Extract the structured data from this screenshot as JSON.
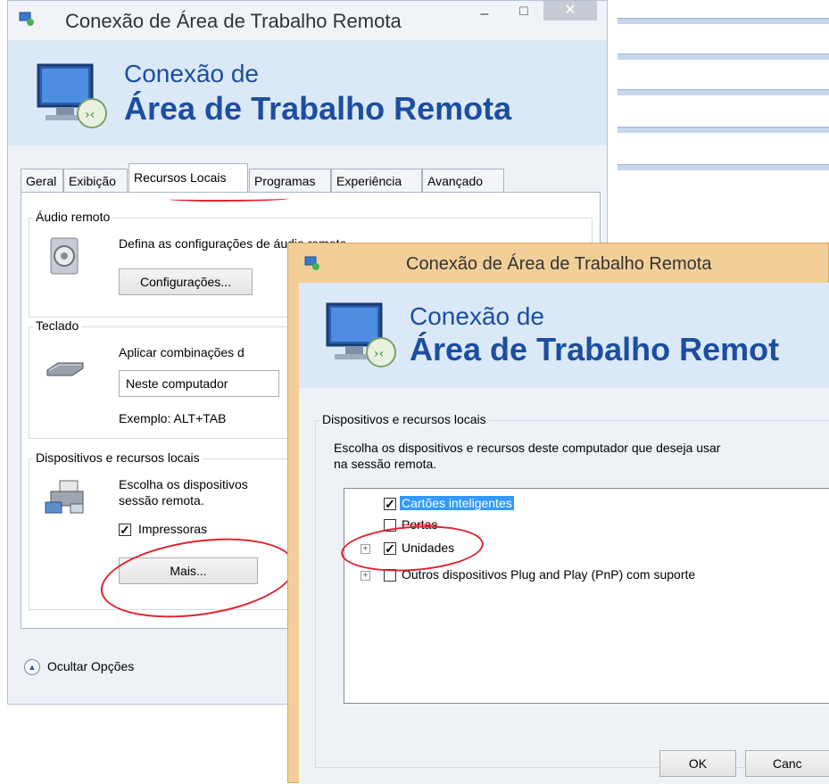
{
  "app_title": "Conexão de Área de Trabalho Remota",
  "main_window": {
    "title": "Conexão de Área de Trabalho Remota",
    "banner_line1": "Conexão de",
    "banner_line2": "Área de Trabalho Remota",
    "window_buttons": {
      "minimize": "–",
      "maximize": "☐",
      "close": "✕"
    },
    "tabs": [
      {
        "label": "Geral",
        "active": false
      },
      {
        "label": "Exibição",
        "active": false
      },
      {
        "label": "Recursos Locais",
        "active": true
      },
      {
        "label": "Programas",
        "active": false
      },
      {
        "label": "Experiência",
        "active": false
      },
      {
        "label": "Avançado",
        "active": false
      }
    ],
    "audio": {
      "group_label": "Áudio remoto",
      "description": "Defina as configurações de áudio remoto",
      "button": "Configurações..."
    },
    "keyboard": {
      "group_label": "Teclado",
      "description": "Aplicar combinações d",
      "selected": "Neste computador",
      "example": "Exemplo: ALT+TAB"
    },
    "devices": {
      "group_label": "Dispositivos e recursos locais",
      "description_line1": "Escolha os dispositivos",
      "description_line2": "sessão remota.",
      "printers_label": "Impressoras",
      "printers_checked": true,
      "more_button": "Mais..."
    },
    "hide_options": "Ocultar Opções"
  },
  "dialog": {
    "title": "Conexão de Área de Trabalho Remota",
    "banner_line1": "Conexão de",
    "banner_line2": "Área de Trabalho Remot",
    "group_label": "Dispositivos e recursos locais",
    "description_line1": "Escolha os dispositivos e recursos deste computador que deseja usar",
    "description_line2": "na sessão remota.",
    "items": [
      {
        "label": "Cartões inteligentes",
        "checked": true,
        "selected": true,
        "expandable": false
      },
      {
        "label": "Portas",
        "checked": false,
        "selected": false,
        "expandable": false
      },
      {
        "label": "Unidades",
        "checked": true,
        "selected": false,
        "expandable": true
      },
      {
        "label": "Outros dispositivos Plug and Play (PnP) com suporte",
        "checked": false,
        "selected": false,
        "expandable": true
      }
    ],
    "ok_button": "OK",
    "cancel_button": "Canc"
  },
  "colors": {
    "annotation_red": "#e0222d",
    "banner_blue": "#1c4ea0",
    "dialog_frame": "#f2cf98"
  }
}
